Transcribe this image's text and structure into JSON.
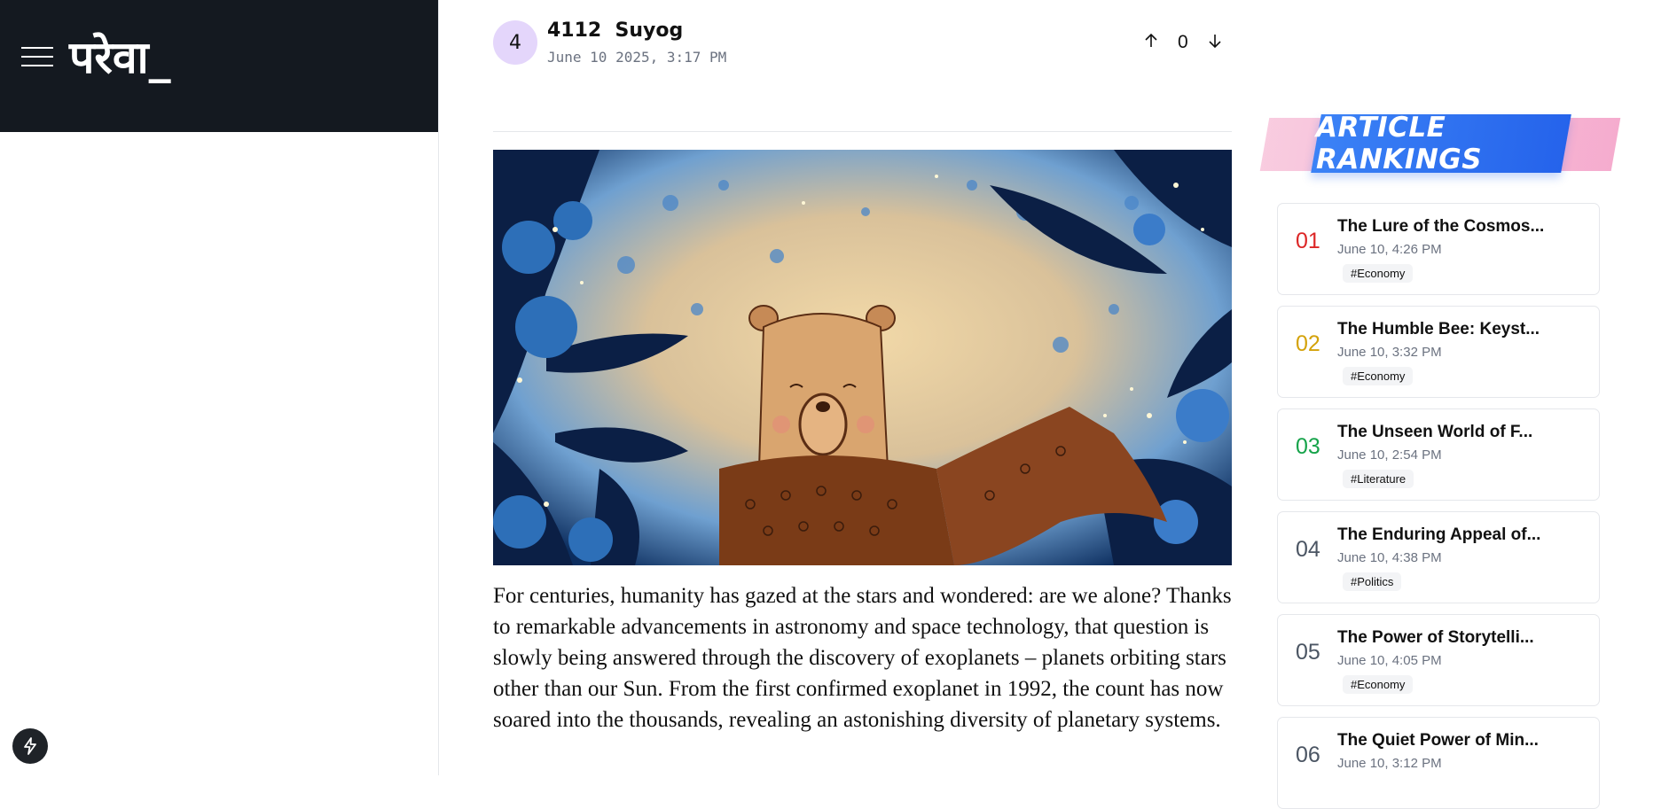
{
  "brand": {
    "logo": "परेवा_"
  },
  "post": {
    "avatar_letter": "4",
    "author": "4112  Suyog",
    "date": "June 10 2025, 3:17 PM",
    "vote_count": "0"
  },
  "article": {
    "paragraph": "For centuries, humanity has gazed at the stars and wondered: are we alone? Thanks to remarkable advancements in astronomy and space technology, that question is slowly being answered through the discovery of exoplanets – planets orbiting stars other than our Sun. From the first confirmed exoplanet in 1992, the count has now soared into the thousands, revealing an astonishing diversity of planetary systems."
  },
  "rankings": {
    "heading": "ARTICLE RANKINGS",
    "items": [
      {
        "rank": "01",
        "title": "The Lure of the Cosmos...",
        "date": "June 10, 4:26 PM",
        "tag": "#Economy",
        "color": "#dc2626"
      },
      {
        "rank": "02",
        "title": "The Humble Bee: Keyst...",
        "date": "June 10, 3:32 PM",
        "tag": "#Economy",
        "color": "#d4a20a"
      },
      {
        "rank": "03",
        "title": "The Unseen World of F...",
        "date": "June 10, 2:54 PM",
        "tag": "#Literature",
        "color": "#16a34a"
      },
      {
        "rank": "04",
        "title": "The Enduring Appeal of...",
        "date": "June 10, 4:38 PM",
        "tag": "#Politics",
        "color": "#4b5563"
      },
      {
        "rank": "05",
        "title": "The Power of Storytelli...",
        "date": "June 10, 4:05 PM",
        "tag": "#Economy",
        "color": "#4b5563"
      },
      {
        "rank": "06",
        "title": "The Quiet Power of Min...",
        "date": "June 10, 3:12 PM",
        "tag": "",
        "color": "#4b5563"
      }
    ]
  },
  "colors": {
    "sidebar_bg": "#141920",
    "avatar_bg": "#e4d6fb",
    "banner_blue": "#2563eb",
    "banner_pink": "#f4a3c9"
  },
  "icons": [
    "menu-icon",
    "arrow-up-icon",
    "arrow-down-icon",
    "bolt-icon"
  ]
}
